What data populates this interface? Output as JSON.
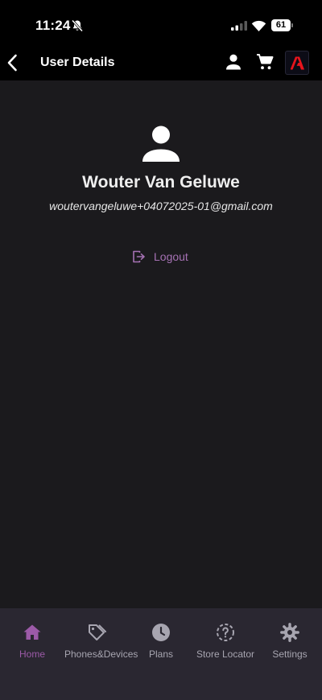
{
  "status_bar": {
    "time": "11:24",
    "battery_level": "61"
  },
  "nav": {
    "title": "User Details"
  },
  "profile": {
    "name": "Wouter Van Geluwe",
    "email": "woutervangeluwe+04072025-01@gmail.com",
    "logout_label": "Logout"
  },
  "tabs": [
    {
      "label": "Home",
      "icon": "home-icon",
      "active": true
    },
    {
      "label": "Phones&Devices",
      "icon": "tag-icon",
      "active": false
    },
    {
      "label": "Plans",
      "icon": "clock-icon",
      "active": false
    },
    {
      "label": "Store Locator",
      "icon": "question-location-icon",
      "active": false
    },
    {
      "label": "Settings",
      "icon": "gear-icon",
      "active": false
    }
  ],
  "colors": {
    "accent": "#9c5aa8",
    "background": "#1b1a1d",
    "tab_bar": "#2a2731",
    "icon_gray": "#a7a5b0",
    "brand_red": "#e8141c"
  }
}
